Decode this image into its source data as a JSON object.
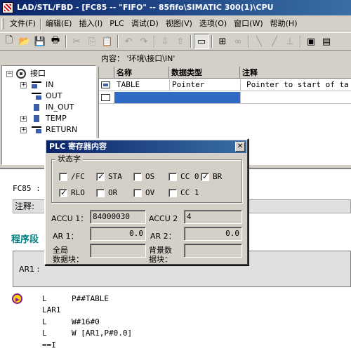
{
  "window": {
    "title": "LAD/STL/FBD  - [FC85 -- \"FIFO\" -- 85fifo\\SIMATIC 300(1)\\CPU"
  },
  "menu": [
    "文件(F)",
    "编辑(E)",
    "插入(I)",
    "PLC",
    "调试(D)",
    "视图(V)",
    "选项(O)",
    "窗口(W)",
    "帮助(H)"
  ],
  "content_header": "内容： '环境\\接口\\IN'",
  "tree": {
    "root": "接口",
    "items": [
      "IN",
      "OUT",
      "IN_OUT",
      "TEMP",
      "RETURN"
    ]
  },
  "grid": {
    "headers": [
      "名称",
      "数据类型",
      "注释"
    ],
    "rows": [
      {
        "name": "TABLE",
        "type": "Pointer",
        "comment": "Pointer to start of ta"
      },
      {
        "name": "",
        "type": "",
        "comment": ""
      }
    ]
  },
  "dialog": {
    "title": "PLC 寄存器内容",
    "status_legend": "状态字",
    "flags": [
      {
        "label": "/FC",
        "checked": false
      },
      {
        "label": "STA",
        "checked": true
      },
      {
        "label": "OS",
        "checked": false
      },
      {
        "label": "CC 0",
        "checked": false
      },
      {
        "label": "BR",
        "checked": true
      },
      {
        "label": "RLO",
        "checked": true
      },
      {
        "label": "OR",
        "checked": false
      },
      {
        "label": "OV",
        "checked": false
      },
      {
        "label": "CC 1",
        "checked": false
      }
    ],
    "accu1_label": "ACCU 1：",
    "accu1_value": "84000030",
    "accu2_label": "ACCU 2",
    "accu2_value": "4",
    "ar1_label": "AR 1：",
    "ar1_value": "0.0",
    "ar2_label": "AR 2：",
    "ar2_value": "0.0",
    "global_db_label_1": "全局",
    "global_db_label_2": "数据块：",
    "instance_db_label_1": "背景数",
    "instance_db_label_2": "据块：",
    "global_db_value": "",
    "instance_db_value": ""
  },
  "editor": {
    "fc_label": "FC85 :",
    "comment_label": "注释:",
    "network_title": "程序段",
    "ar1_label": "AR1 :",
    "code": [
      {
        "op": "L",
        "arg": "P##TABLE"
      },
      {
        "op": "LAR1",
        "arg": ""
      },
      {
        "op": "L",
        "arg": "W#16#0"
      },
      {
        "op": "L",
        "arg": "W [AR1,P#0.0]"
      },
      {
        "op": "==I",
        "arg": ""
      }
    ]
  }
}
